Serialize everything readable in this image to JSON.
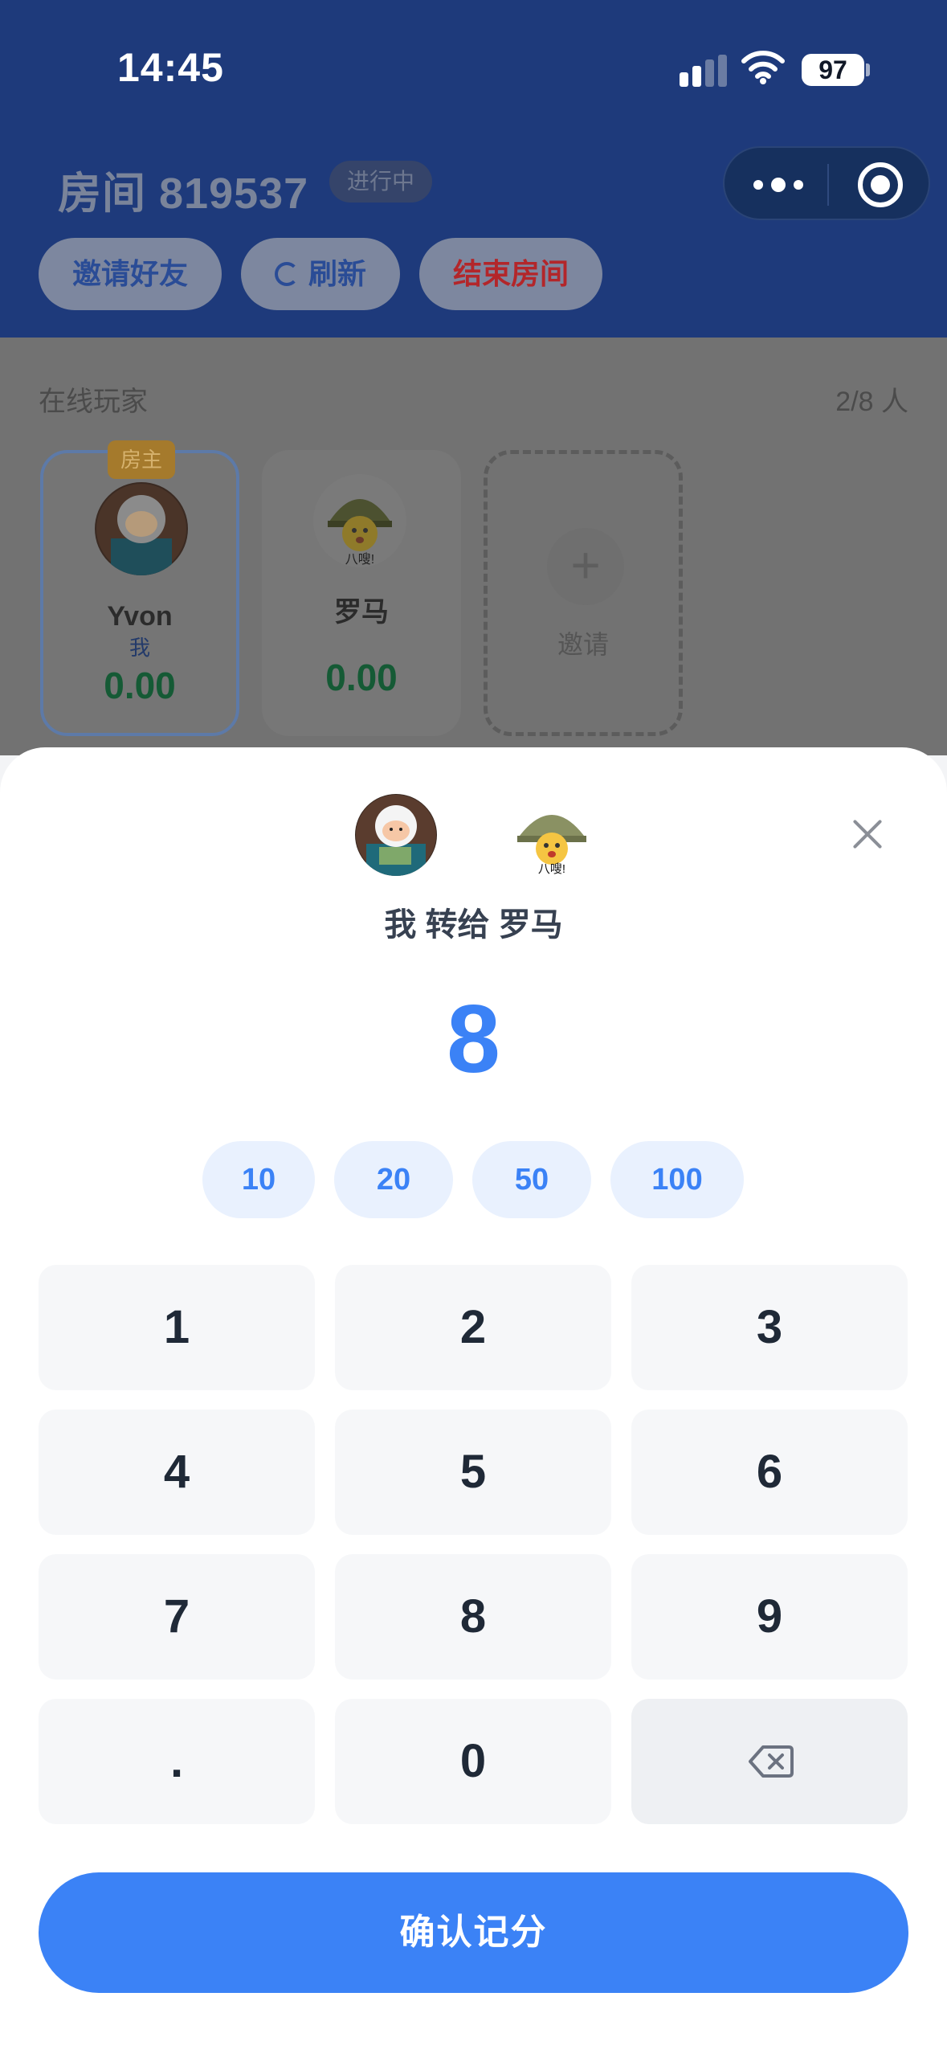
{
  "status_bar": {
    "time": "14:45",
    "battery": "97"
  },
  "room": {
    "title": "房间 819537",
    "status": "进行中"
  },
  "header_buttons": {
    "invite": "邀请好友",
    "refresh": "刷新",
    "end": "结束房间"
  },
  "players_section": {
    "label": "在线玩家",
    "count": "2/8 人",
    "players": [
      {
        "host_tag": "房主",
        "name": "Yvon",
        "me_label": "我",
        "score": "0.00"
      },
      {
        "name": "罗马",
        "score": "0.00",
        "avatar_caption": "八嗖!"
      }
    ],
    "invite_label": "邀请"
  },
  "transfer": {
    "from": "我",
    "verb": "转给",
    "to": "罗马",
    "amount": "8",
    "to_avatar_caption": "八嗖!"
  },
  "quick_amounts": [
    "10",
    "20",
    "50",
    "100"
  ],
  "keypad": [
    "1",
    "2",
    "3",
    "4",
    "5",
    "6",
    "7",
    "8",
    "9",
    ".",
    "0"
  ],
  "confirm_label": "确认记分",
  "colors": {
    "header_bg": "#1e3a7b",
    "accent": "#3b82f6",
    "score_green": "#16a34a",
    "end_red": "#dc2626"
  }
}
